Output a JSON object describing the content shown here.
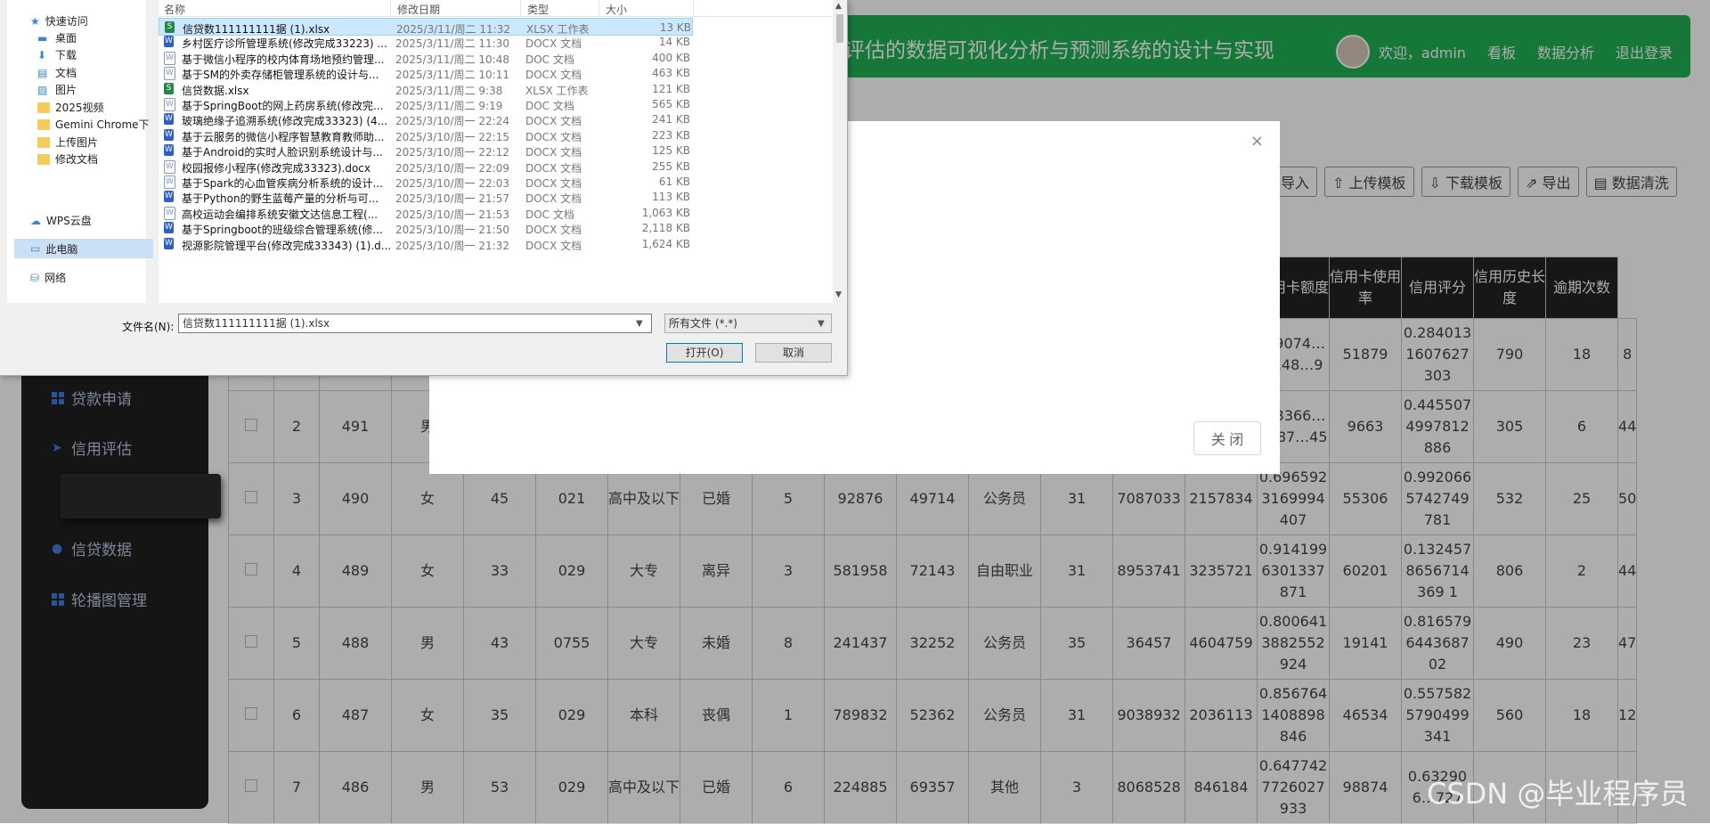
{
  "header": {
    "title": "评估的数据可视化分析与预测系统的设计与实现",
    "welcome": "欢迎，admin",
    "nav": [
      "看板",
      "数据分析",
      "退出登录"
    ]
  },
  "sidebar": {
    "items": [
      "贷款申请",
      "信用评估",
      "",
      "信贷数据",
      "轮播图管理"
    ]
  },
  "toolbar": {
    "buttons": [
      "导入",
      "上传模板",
      "下载模板",
      "导出",
      "数据清洗"
    ]
  },
  "table": {
    "headers": [
      "",
      "",
      "",
      "",
      "",
      "",
      "",
      "",
      "",
      "",
      "",
      "",
      "",
      "",
      "率",
      "信用卡额度",
      "信用卡使用率",
      "信用评分",
      "信用历史长度",
      "逾期次数"
    ],
    "rows": [
      [
        "",
        "",
        "",
        "",
        "",
        "",
        "",
        "",
        "",
        "",
        "",
        "",
        "",
        "",
        "0.9074…6148…9",
        "51879",
        "0.2840131607627303",
        "790",
        "18",
        "8"
      ],
      [
        "2",
        "491",
        "男",
        "",
        "",
        "",
        "",
        "",
        "",
        "",
        "",
        "",
        "",
        "",
        "…3366…7587…45",
        "9663",
        "0.4455074997812886",
        "305",
        "6",
        "44"
      ],
      [
        "3",
        "490",
        "女",
        "45",
        "021",
        "高中及以下",
        "已婚",
        "5",
        "92876",
        "49714",
        "公务员",
        "31",
        "7087033",
        "2157834",
        "0.6965923169994407",
        "55306",
        "0.9920665742749781",
        "532",
        "25",
        "50"
      ],
      [
        "4",
        "489",
        "女",
        "33",
        "029",
        "大专",
        "离异",
        "3",
        "581958",
        "72143",
        "自由职业",
        "31",
        "8953741",
        "3235721",
        "0.9141996301337871",
        "60201",
        "0.1324578656714369 1",
        "806",
        "2",
        "44"
      ],
      [
        "5",
        "488",
        "男",
        "43",
        "0755",
        "大专",
        "未婚",
        "8",
        "241437",
        "32252",
        "公务员",
        "35",
        "36457",
        "4604759",
        "0.8006413882552924",
        "19141",
        "0.8165796443687 02",
        "490",
        "23",
        "47"
      ],
      [
        "6",
        "487",
        "女",
        "35",
        "029",
        "本科",
        "丧偶",
        "1",
        "789832",
        "52362",
        "公务员",
        "31",
        "9038932",
        "2036113",
        "0.8567641408898846",
        "46534",
        "0.5575825790499341",
        "560",
        "18",
        "12"
      ],
      [
        "7",
        "486",
        "男",
        "53",
        "029",
        "高中及以下",
        "已婚",
        "6",
        "224885",
        "69357",
        "其他",
        "3",
        "8068528",
        "846184",
        "0.6477427726027933",
        "98874",
        "0.632906…727",
        "",
        "",
        ""
      ]
    ]
  },
  "modal": {
    "close_icon": "×",
    "close_button": "关 闭"
  },
  "file_dialog": {
    "nav": {
      "quick_access": "快速访问",
      "items": [
        "桌面",
        "下载",
        "文档",
        "图片",
        "2025视频",
        "Gemini Chrome下",
        "上传图片",
        "修改文档"
      ],
      "wps": "WPS云盘",
      "this_pc": "此电脑",
      "network": "网络"
    },
    "columns": [
      "名称",
      "修改日期",
      "类型",
      "大小"
    ],
    "files": [
      {
        "name": "信贷数111111111据 (1).xlsx",
        "date": "2025/3/11/周二 11:32",
        "type": "XLSX 工作表",
        "size": "13 KB",
        "icon": "xlsx"
      },
      {
        "name": "乡村医疗诊所管理系统(修改完成33223) ...",
        "date": "2025/3/11/周二 11:30",
        "type": "DOCX 文档",
        "size": "14 KB",
        "icon": "docx"
      },
      {
        "name": "基于微信小程序的校内体育场地预约管理...",
        "date": "2025/3/11/周二 10:48",
        "type": "DOC 文档",
        "size": "400 KB",
        "icon": "doc"
      },
      {
        "name": "基于SM的外卖存储柜管理系统的设计与...",
        "date": "2025/3/11/周二 10:11",
        "type": "DOCX 文档",
        "size": "463 KB",
        "icon": "doc"
      },
      {
        "name": "信贷数据.xlsx",
        "date": "2025/3/11/周二 9:38",
        "type": "XLSX 工作表",
        "size": "121 KB",
        "icon": "xlsx"
      },
      {
        "name": "基于SpringBoot的网上药房系统(修改完...",
        "date": "2025/3/11/周二 9:19",
        "type": "DOC 文档",
        "size": "565 KB",
        "icon": "doc"
      },
      {
        "name": "玻璃绝缘子追溯系统(修改完成33323) (4...",
        "date": "2025/3/10/周一 22:24",
        "type": "DOCX 文档",
        "size": "241 KB",
        "icon": "docx"
      },
      {
        "name": "基于云服务的微信小程序智慧教育教师助...",
        "date": "2025/3/10/周一 22:15",
        "type": "DOCX 文档",
        "size": "223 KB",
        "icon": "docx"
      },
      {
        "name": "基于Android的实时人脸识别系统设计与...",
        "date": "2025/3/10/周一 22:12",
        "type": "DOCX 文档",
        "size": "125 KB",
        "icon": "docx"
      },
      {
        "name": "校园报修小程序(修改完成33323).docx",
        "date": "2025/3/10/周一 22:09",
        "type": "DOCX 文档",
        "size": "255 KB",
        "icon": "doc"
      },
      {
        "name": "基于Spark的心血管疾病分析系统的设计...",
        "date": "2025/3/10/周一 22:03",
        "type": "DOCX 文档",
        "size": "61 KB",
        "icon": "doc"
      },
      {
        "name": "基于Python的野生蓝莓产量的分析与可...",
        "date": "2025/3/10/周一 21:57",
        "type": "DOCX 文档",
        "size": "113 KB",
        "icon": "docx"
      },
      {
        "name": "高校运动会编排系统安徽文达信息工程(...",
        "date": "2025/3/10/周一 21:53",
        "type": "DOC 文档",
        "size": "1,063 KB",
        "icon": "doc"
      },
      {
        "name": "基于Springboot的班级综合管理系统(修...",
        "date": "2025/3/10/周一 21:50",
        "type": "DOCX 文档",
        "size": "2,118 KB",
        "icon": "docx"
      },
      {
        "name": "视源影院管理平台(修改完成33343) (1).d...",
        "date": "2025/3/10/周一 21:32",
        "type": "DOCX 文档",
        "size": "1,624 KB",
        "icon": "docx"
      }
    ],
    "filename_label": "文件名(N):",
    "filename_value": "信贷数111111111据 (1).xlsx",
    "filetype_value": "所有文件 (*.*)",
    "open_button": "打开(O)",
    "cancel_button": "取消"
  },
  "watermark": "CSDN @毕业程序员"
}
